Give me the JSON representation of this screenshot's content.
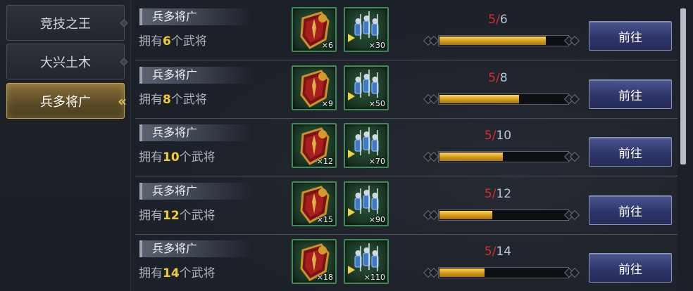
{
  "sidebar": {
    "tabs": [
      {
        "label": "竞技之王",
        "active": false
      },
      {
        "label": "大兴土木",
        "active": false
      },
      {
        "label": "兵多将广",
        "active": true
      }
    ],
    "active_arrows": "«"
  },
  "tasks": [
    {
      "title": "兵多将广",
      "desc_prefix": "拥有",
      "desc_num": "6",
      "desc_suffix": "个武将",
      "rewards": [
        {
          "icon": "shield-icon",
          "count": "×6"
        },
        {
          "icon": "troops-icon",
          "count": "×30"
        }
      ],
      "progress": {
        "current": "5",
        "sep": "/",
        "total": "6",
        "fraction": 0.833
      },
      "button": "前往"
    },
    {
      "title": "兵多将广",
      "desc_prefix": "拥有",
      "desc_num": "8",
      "desc_suffix": "个武将",
      "rewards": [
        {
          "icon": "shield-icon",
          "count": "×9"
        },
        {
          "icon": "troops-icon",
          "count": "×50"
        }
      ],
      "progress": {
        "current": "5",
        "sep": "/",
        "total": "8",
        "fraction": 0.625
      },
      "button": "前往"
    },
    {
      "title": "兵多将广",
      "desc_prefix": "拥有",
      "desc_num": "10",
      "desc_suffix": "个武将",
      "rewards": [
        {
          "icon": "shield-icon",
          "count": "×12"
        },
        {
          "icon": "troops-icon",
          "count": "×70"
        }
      ],
      "progress": {
        "current": "5",
        "sep": "/",
        "total": "10",
        "fraction": 0.5
      },
      "button": "前往"
    },
    {
      "title": "兵多将广",
      "desc_prefix": "拥有",
      "desc_num": "12",
      "desc_suffix": "个武将",
      "rewards": [
        {
          "icon": "shield-icon",
          "count": "×15"
        },
        {
          "icon": "troops-icon",
          "count": "×90"
        }
      ],
      "progress": {
        "current": "5",
        "sep": "/",
        "total": "12",
        "fraction": 0.417
      },
      "button": "前往"
    },
    {
      "title": "兵多将广",
      "desc_prefix": "拥有",
      "desc_num": "14",
      "desc_suffix": "个武将",
      "rewards": [
        {
          "icon": "shield-icon",
          "count": "×18"
        },
        {
          "icon": "troops-icon",
          "count": "×110"
        }
      ],
      "progress": {
        "current": "5",
        "sep": "/",
        "total": "14",
        "fraction": 0.357
      },
      "button": "前往"
    }
  ],
  "colors": {
    "accent_gold": "#f2cf2c",
    "progress_current": "#d92d2d",
    "button_blue": "#2e356a"
  }
}
